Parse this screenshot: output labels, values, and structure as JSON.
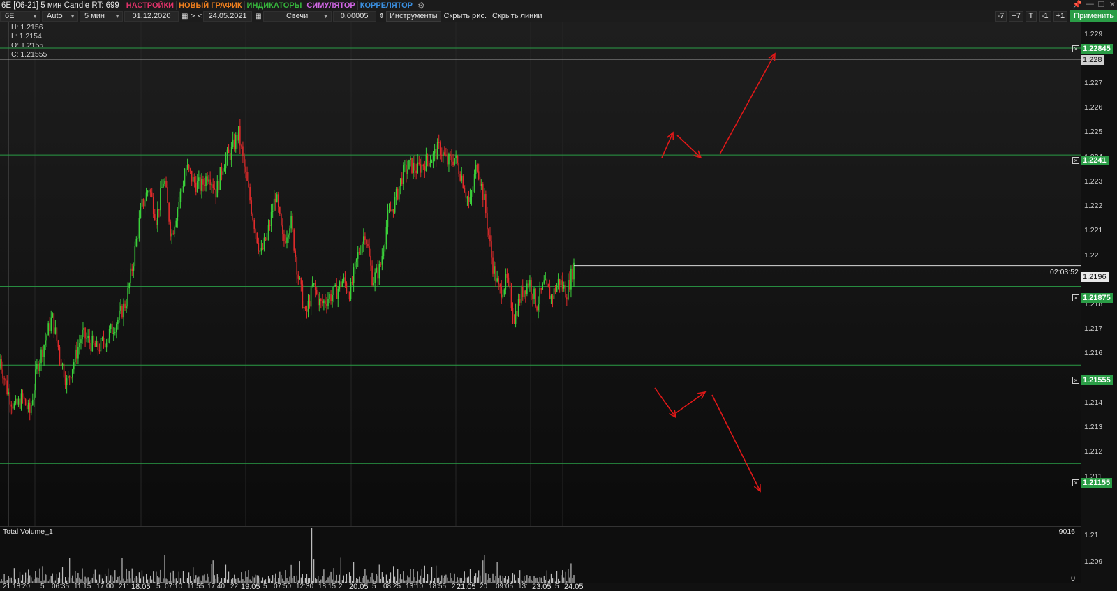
{
  "window": {
    "title": "6E [06-21] 5 мин Candle RT: 699",
    "menu": [
      {
        "label": "НАСТРОЙКИ",
        "color": "#e0336a"
      },
      {
        "label": "НОВЫЙ ГРАФИК",
        "color": "#ee7f1e"
      },
      {
        "label": "ИНДИКАТОРЫ",
        "color": "#36b43c"
      },
      {
        "label": "СИМУЛЯТОР",
        "color": "#d267e6"
      },
      {
        "label": "КОРРЕЛЯТОР",
        "color": "#3a8fe0"
      }
    ],
    "icons": {
      "settings": "gears-icon",
      "pin": "pin-icon",
      "minimize": "minimize-icon",
      "restore": "restore-icon",
      "close": "close-icon"
    }
  },
  "toolbar": {
    "symbol": "6E",
    "mode": "Auto",
    "timeframe": "5 мин",
    "date_from": "01.12.2020",
    "nav_next": ">",
    "nav_prev": "<",
    "date_to": "24.05.2021",
    "chart_type": "Свечи",
    "tick_size": "0.00005",
    "instruments": "Инструменты",
    "hide_drawings": "Скрыть рис.",
    "hide_lines": "Скрыть линии",
    "steps": [
      "-7",
      "+7",
      "T",
      "-1",
      "+1"
    ],
    "apply": "Применить"
  },
  "ohlc": {
    "high": "H: 1.2156",
    "low": "L: 1.2154",
    "open": "O: 1.2155",
    "close": "C: 1.21555"
  },
  "price_axis": {
    "ticks": [
      "1.229",
      "1.228",
      "1.227",
      "1.226",
      "1.225",
      "1.224",
      "1.223",
      "1.222",
      "1.221",
      "1.22",
      "1.219",
      "1.218",
      "1.217",
      "1.216",
      "1.215",
      "1.214",
      "1.213",
      "1.212",
      "1.211",
      "1.21",
      "1.209"
    ],
    "tick_values": [
      1.229,
      1.228,
      1.227,
      1.226,
      1.225,
      1.224,
      1.223,
      1.222,
      1.221,
      1.22,
      1.219,
      1.218,
      1.217,
      1.216,
      1.215,
      1.214,
      1.213,
      1.212,
      1.211,
      1.21,
      1.209
    ],
    "range": [
      1.209,
      1.2295
    ]
  },
  "levels": [
    {
      "label": "1.22845",
      "value": 1.22845,
      "color": "#2a9d46"
    },
    {
      "label": "1.2241",
      "value": 1.2241,
      "color": "#2a9d46"
    },
    {
      "label": "1.21875",
      "value": 1.21875,
      "color": "#2a9d46"
    },
    {
      "label": "1.21555",
      "value": 1.21555,
      "color": "#2a9d46"
    },
    {
      "label": "1.21155",
      "value": 1.21155,
      "color": "#2a9d46"
    }
  ],
  "grey_level": {
    "label": "1.228",
    "value": 1.228
  },
  "current": {
    "label": "1.2196",
    "value": 1.2196,
    "timer": "02:03:52"
  },
  "volume": {
    "title": "Total Volume_1",
    "max_label": "9016",
    "min_label": "0"
  },
  "time_axis": {
    "labels": [
      {
        "text": "21 18:20",
        "day": false
      },
      {
        "text": "5",
        "day": false
      },
      {
        "text": "06:35",
        "day": false
      },
      {
        "text": "11:15",
        "day": false
      },
      {
        "text": "17:00",
        "day": false
      },
      {
        "text": "21:",
        "day": false
      },
      {
        "text": "18.05",
        "day": true
      },
      {
        "text": "5",
        "day": false
      },
      {
        "text": "07:10",
        "day": false
      },
      {
        "text": "11:55",
        "day": false
      },
      {
        "text": "17:40",
        "day": false
      },
      {
        "text": "22",
        "day": false
      },
      {
        "text": "19.05",
        "day": true
      },
      {
        "text": "5",
        "day": false
      },
      {
        "text": "07:50",
        "day": false
      },
      {
        "text": "12:30",
        "day": false
      },
      {
        "text": "18:15",
        "day": false
      },
      {
        "text": "2",
        "day": false
      },
      {
        "text": "20.05",
        "day": true
      },
      {
        "text": "5",
        "day": false
      },
      {
        "text": "08:25",
        "day": false
      },
      {
        "text": "13:10",
        "day": false
      },
      {
        "text": "18:55",
        "day": false
      },
      {
        "text": "2",
        "day": false
      },
      {
        "text": "21.05",
        "day": true
      },
      {
        "text": "20",
        "day": false
      },
      {
        "text": "09:05",
        "day": false
      },
      {
        "text": "13:",
        "day": false
      },
      {
        "text": "23.05",
        "day": true
      },
      {
        "text": "5",
        "day": false
      },
      {
        "text": "24.05",
        "day": true
      }
    ]
  },
  "colors": {
    "up": "#3bd13b",
    "down": "#e02b2b",
    "level": "#2a9d46",
    "arrow": "#e01818",
    "background": "#111111"
  },
  "series": {
    "start": 1.2154,
    "keypoints": [
      1.2158,
      1.2145,
      1.2138,
      1.2142,
      1.2136,
      1.2155,
      1.2165,
      1.2175,
      1.216,
      1.2148,
      1.2158,
      1.2168,
      1.2165,
      1.2162,
      1.2165,
      1.217,
      1.2175,
      1.2182,
      1.22,
      1.222,
      1.2228,
      1.2215,
      1.2232,
      1.2208,
      1.2222,
      1.2236,
      1.223,
      1.2228,
      1.2234,
      1.2226,
      1.2238,
      1.2242,
      1.225,
      1.2232,
      1.2215,
      1.22,
      1.221,
      1.2225,
      1.2205,
      1.2215,
      1.2192,
      1.2175,
      1.2188,
      1.218,
      1.2183,
      1.2185,
      1.219,
      1.2185,
      1.22,
      1.221,
      1.219,
      1.2195,
      1.2215,
      1.2222,
      1.2233,
      1.2237,
      1.2235,
      1.2238,
      1.224,
      1.2244,
      1.2238,
      1.224,
      1.2232,
      1.222,
      1.2238,
      1.2222,
      1.2198,
      1.2185,
      1.219,
      1.2175,
      1.2185,
      1.219,
      1.218,
      1.2188,
      1.2183,
      1.219,
      1.2185,
      1.2196
    ],
    "volumes": [
      1,
      3,
      2,
      5,
      1,
      2,
      4,
      3,
      2,
      1,
      6,
      2,
      1,
      3,
      7,
      2,
      4,
      1,
      5,
      2,
      8,
      3,
      4,
      1,
      2,
      6,
      3,
      2,
      5,
      1,
      9,
      2,
      3,
      4,
      1,
      2,
      3,
      7,
      1,
      2,
      4,
      3,
      5,
      2,
      6,
      1,
      4,
      2,
      3,
      9,
      2,
      3,
      1,
      4,
      2,
      5,
      3,
      2,
      10,
      1,
      3,
      2,
      4,
      1,
      2,
      3,
      5,
      6,
      2,
      1,
      3,
      4,
      2,
      1,
      5,
      3,
      7,
      2,
      4,
      3,
      1,
      6,
      2,
      3,
      4,
      2,
      9,
      3,
      1,
      5,
      2,
      4,
      3,
      6,
      1,
      2,
      4,
      3,
      5,
      2,
      8,
      3,
      1,
      4,
      2,
      3,
      5,
      2,
      7,
      1,
      4,
      3,
      2,
      6,
      1,
      3,
      12,
      2,
      3,
      1,
      4,
      2,
      5,
      3,
      2,
      1,
      4,
      3,
      2,
      5,
      1,
      3,
      2,
      4,
      3,
      1,
      6,
      2,
      4,
      3,
      5,
      1,
      2,
      3,
      4,
      2,
      6,
      3,
      1,
      8,
      13,
      4,
      2,
      5,
      3,
      1,
      4,
      2,
      3,
      7,
      2,
      4,
      1,
      3,
      2,
      5,
      3,
      4,
      2,
      1,
      6,
      3,
      2,
      4,
      3,
      5,
      2,
      1,
      3,
      2,
      4,
      3,
      5,
      2,
      1,
      3,
      2,
      2,
      1,
      3,
      2
    ]
  }
}
